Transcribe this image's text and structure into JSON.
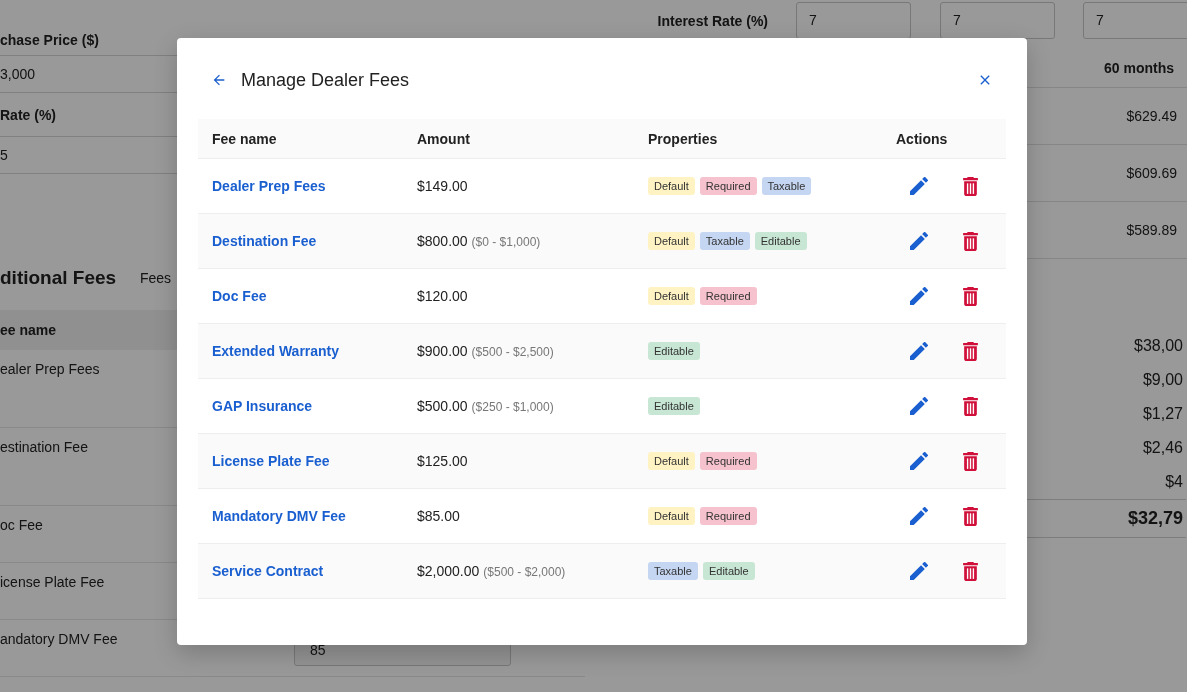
{
  "page": {
    "price_labels": [
      "chase Price ($)"
    ],
    "price_value": "3,000",
    "rate_label": "Rate (%)",
    "rate_value": "5",
    "fees_heading": "ditional Fees",
    "fees_note": "Fees",
    "fees_column": "ee name",
    "fees": [
      {
        "name": "ealer Prep Fees",
        "tall": true
      },
      {
        "name": "estination Fee",
        "tall": true
      },
      {
        "name": "oc Fee",
        "tall": false
      },
      {
        "name": "icense Plate Fee",
        "tall": false
      },
      {
        "name": "andatory DMV Fee",
        "tall": false,
        "value": "85"
      }
    ],
    "interest_label": "Interest Rate (%)",
    "interest_inputs": [
      "7",
      "7",
      "7"
    ],
    "term_columns": [
      "60 months"
    ],
    "payments": [
      "$629.49",
      "$609.69",
      "$589.89"
    ],
    "summary": [
      "$38,00",
      "$9,00",
      "$1,27",
      "$2,46",
      "$4"
    ],
    "total": "$32,79"
  },
  "dialog": {
    "title": "Manage Dealer Fees",
    "columns": [
      "Fee name",
      "Amount",
      "Properties",
      "Actions"
    ],
    "rows": [
      {
        "name": "Dealer Prep Fees",
        "amount": "$149.00",
        "tags": [
          {
            "label": "Default",
            "kind": "default"
          },
          {
            "label": "Required",
            "kind": "required"
          },
          {
            "label": "Taxable",
            "kind": "taxable"
          }
        ]
      },
      {
        "name": "Destination Fee",
        "amount": "$800.00",
        "range": "($0 - $1,000)",
        "tags": [
          {
            "label": "Default",
            "kind": "default"
          },
          {
            "label": "Taxable",
            "kind": "taxable"
          },
          {
            "label": "Editable",
            "kind": "editable"
          }
        ]
      },
      {
        "name": "Doc Fee",
        "amount": "$120.00",
        "tags": [
          {
            "label": "Default",
            "kind": "default"
          },
          {
            "label": "Required",
            "kind": "required"
          }
        ]
      },
      {
        "name": "Extended Warranty",
        "amount": "$900.00",
        "range": "($500 - $2,500)",
        "tags": [
          {
            "label": "Editable",
            "kind": "editable"
          }
        ]
      },
      {
        "name": "GAP Insurance",
        "amount": "$500.00",
        "range": "($250 - $1,000)",
        "tags": [
          {
            "label": "Editable",
            "kind": "editable"
          }
        ]
      },
      {
        "name": "License Plate Fee",
        "amount": "$125.00",
        "tags": [
          {
            "label": "Default",
            "kind": "default"
          },
          {
            "label": "Required",
            "kind": "required"
          }
        ]
      },
      {
        "name": "Mandatory DMV Fee",
        "amount": "$85.00",
        "tags": [
          {
            "label": "Default",
            "kind": "default"
          },
          {
            "label": "Required",
            "kind": "required"
          }
        ]
      },
      {
        "name": "Service Contract",
        "amount": "$2,000.00",
        "range": "($500 - $2,000)",
        "tags": [
          {
            "label": "Taxable",
            "kind": "taxable"
          },
          {
            "label": "Editable",
            "kind": "editable"
          }
        ]
      }
    ]
  }
}
